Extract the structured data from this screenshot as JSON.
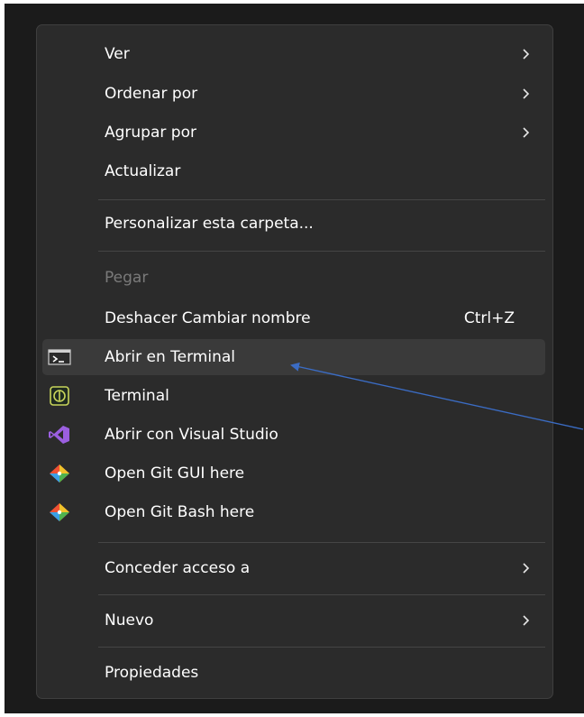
{
  "menu": {
    "items": [
      {
        "label": "Ver",
        "submenu": true
      },
      {
        "label": "Ordenar por",
        "submenu": true
      },
      {
        "label": "Agrupar por",
        "submenu": true
      },
      {
        "label": "Actualizar"
      },
      {
        "label": "Personalizar esta carpeta..."
      },
      {
        "label": "Pegar",
        "disabled": true
      },
      {
        "label": "Deshacer Cambiar nombre",
        "shortcut": "Ctrl+Z"
      },
      {
        "label": "Abrir en Terminal",
        "icon": "terminal-prompt-icon",
        "highlighted": true
      },
      {
        "label": "Terminal",
        "icon": "conemu-terminal-icon"
      },
      {
        "label": "Abrir con Visual Studio",
        "icon": "visual-studio-icon"
      },
      {
        "label": "Open Git GUI here",
        "icon": "git-icon"
      },
      {
        "label": "Open Git Bash here",
        "icon": "git-icon"
      },
      {
        "label": "Conceder acceso a",
        "submenu": true
      },
      {
        "label": "Nuevo",
        "submenu": true
      },
      {
        "label": "Propiedades"
      }
    ]
  },
  "colors": {
    "menu_background": "#2b2b2b",
    "hover_background": "#3a3a3a",
    "text": "#ffffff",
    "disabled_text": "#7a7a7a",
    "separator": "#454545",
    "annotation_arrow": "#3b6cc4"
  },
  "annotation": {
    "type": "arrow",
    "points_to": "Abrir en Terminal"
  }
}
